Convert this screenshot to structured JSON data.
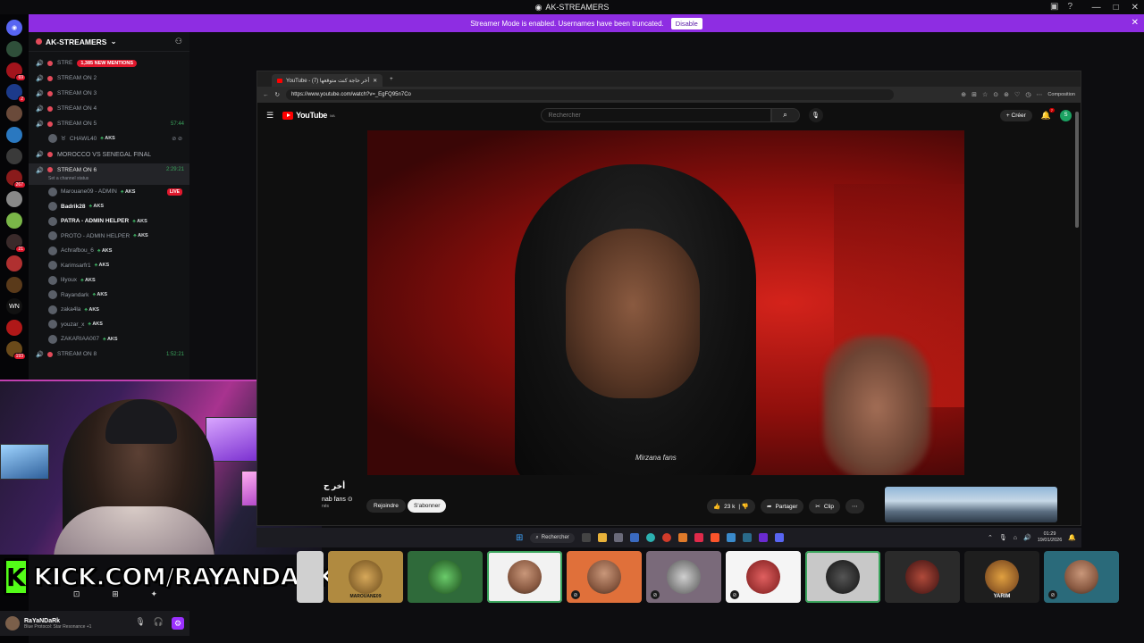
{
  "window": {
    "title": "AK-STREAMERS",
    "controls": [
      "—",
      "□",
      "✕"
    ]
  },
  "banner": {
    "text": "Streamer Mode is enabled. Usernames have been truncated.",
    "button": "Disable"
  },
  "server_rail": {
    "badges": [
      "",
      "69",
      "2",
      "",
      "267",
      "21",
      "",
      "",
      "",
      "WN",
      "",
      "193"
    ]
  },
  "sidebar": {
    "server_name": "AK-STREAMERS",
    "mentions": "1,385 NEW MENTIONS",
    "channels": [
      {
        "label": "STRE",
        "time": "",
        "mention": true
      },
      {
        "label": "STREAM ON 2",
        "time": ""
      },
      {
        "label": "STREAM ON 3",
        "time": ""
      },
      {
        "label": "STREAM ON 4",
        "time": ""
      },
      {
        "label": "STREAM ON 5",
        "time": "57:44"
      }
    ],
    "ch5_user": {
      "name": "CHAWL40",
      "tag": "AKS"
    },
    "category": "MOROCCO VS SENEGAL FINAL",
    "active_channel": {
      "label": "STREAM ON 6",
      "time": "2:29:21",
      "status": "Set a channel status"
    },
    "users": [
      {
        "name": "Marouane09 - ADMIN",
        "tag": "AKS",
        "live": "LIVE",
        "bright": false
      },
      {
        "name": "Badrik28",
        "tag": "AKS",
        "bright": true
      },
      {
        "name": "PATRA - ADMIN HELPER",
        "tag": "AKS",
        "bright": true
      },
      {
        "name": "PROTO - ADMIN HELPER",
        "tag": "AKS",
        "bright": false
      },
      {
        "name": "Achrafbou_6",
        "tag": "AKS",
        "bright": false
      },
      {
        "name": "Karimsarfr1",
        "tag": "AKS",
        "bright": false
      },
      {
        "name": "lilyoux",
        "tag": "AKS",
        "bright": false
      },
      {
        "name": "Rayandark",
        "tag": "AKS",
        "bright": false
      },
      {
        "name": "zaka4la",
        "tag": "AKS",
        "bright": false
      },
      {
        "name": "youzar_x",
        "tag": "AKS",
        "bright": false
      },
      {
        "name": "ZAKARIAA007",
        "tag": "AKS",
        "bright": false
      }
    ],
    "next_channel": {
      "label": "STREAM ON 8",
      "time": "1:52:21"
    }
  },
  "kick": {
    "logo": "K",
    "url": "KICK.COM/RAYANDARK"
  },
  "userbar": {
    "name": "RaYaNDaRk",
    "status": "Blue Protocol: Star Resonance +1"
  },
  "browser": {
    "tab_title": "YouTube - أخر حاجة كنت متوقعها (7)",
    "url": "https://www.youtube.com/watch?v=_EgFQ95n7Co",
    "composition": "Composition",
    "youtube": {
      "logo": "YouTube",
      "region": "MA",
      "search_placeholder": "Rechercher",
      "create": "Créer",
      "notif_count": "7",
      "avatar": "S",
      "video_title": "أخر ح",
      "channel": "nab fans",
      "subs": "nés",
      "join": "Rejoindre",
      "subscribe": "S'abonner",
      "likes": "23 k",
      "share": "Partager",
      "clip": "Clip",
      "brand": "Mirzana fans"
    }
  },
  "taskbar": {
    "search": "Rechercher",
    "time": "01:29",
    "date": "19/01/2026"
  },
  "tiles": {
    "labels": [
      "",
      "MAROUANE09",
      "",
      "",
      "",
      "",
      "",
      "",
      "",
      "YARIM",
      ""
    ]
  },
  "colors": {
    "accent": "#8e2de2",
    "kick_green": "#53fc18",
    "live_red": "#e0182d",
    "voice_green": "#3ba55d"
  }
}
